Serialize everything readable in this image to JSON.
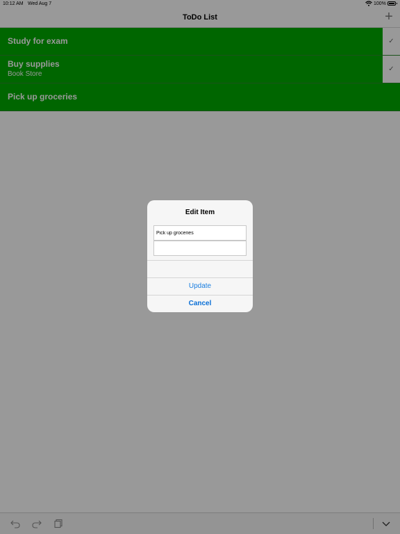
{
  "status": {
    "time": "10:12 AM",
    "date": "Wed Aug 7",
    "battery": "100%"
  },
  "nav": {
    "title": "ToDo List",
    "add_icon": "plus-icon"
  },
  "items": [
    {
      "title": "Study for exam",
      "subtitle": "",
      "checked": true
    },
    {
      "title": "Buy supplies",
      "subtitle": "Book Store",
      "checked": true
    },
    {
      "title": "Pick up groceries",
      "subtitle": "",
      "checked": false
    }
  ],
  "dialog": {
    "title": "Edit Item",
    "field1_value": "Pick up groceries",
    "field2_value": "",
    "update_label": "Update",
    "cancel_label": "Cancel"
  },
  "toolbar": {
    "icons": [
      "undo-icon",
      "redo-icon",
      "paste-icon",
      "chevron-down-icon"
    ]
  },
  "colors": {
    "row_green": "#00aa00",
    "overlay": "rgba(0,0,0,0.4)",
    "link_blue": "#1a7ee0"
  }
}
